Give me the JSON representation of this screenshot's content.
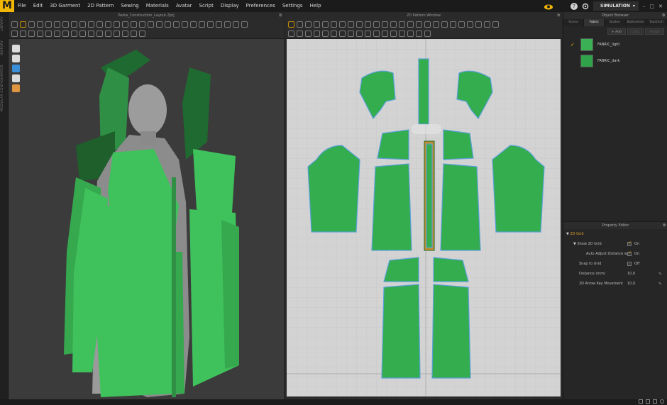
{
  "app": {
    "logo": "M",
    "menu": [
      "File",
      "Edit",
      "3D Garment",
      "2D Pattern",
      "Sewing",
      "Materials",
      "Avatar",
      "Script",
      "Display",
      "Preferences",
      "Settings",
      "Help"
    ],
    "simulation_label": "SIMULATION",
    "help_glyph": "?",
    "window_controls": [
      "–",
      "□",
      "✕"
    ]
  },
  "left_tabs": [
    "LIBRARY",
    "HISTORY",
    "MODULAR CONFIGURATOR"
  ],
  "window3d": {
    "title": "Parka_Construction_Layout.Zprj"
  },
  "window2d": {
    "title": "2D Pattern Window"
  },
  "object_browser": {
    "title": "Object Browser",
    "tabs": [
      "Scene",
      "Fabric",
      "Button",
      "Buttonhole",
      "Topstitch"
    ],
    "active_tab": "Fabric",
    "add_label": "+ Add",
    "copy_label": "Copy",
    "assign_label": "Assign",
    "fabrics": [
      {
        "name": "FABRIC_light",
        "color": "#3ec35c",
        "selected": true
      },
      {
        "name": "FABRIC_dark",
        "color": "#2fa24a",
        "selected": false
      }
    ]
  },
  "property_editor": {
    "title": "Property Editor",
    "section": "2D Grid",
    "rows": [
      {
        "label": "Show 2D Grid",
        "value": "On",
        "checked": true,
        "indent": 2,
        "expander": true
      },
      {
        "label": "Auto Adjust Distance wi",
        "value": "On",
        "checked": true,
        "indent": 3
      },
      {
        "label": "Snap to Grid",
        "value": "Off",
        "checked": false,
        "indent": 1
      },
      {
        "label": "Distance (mm)",
        "value": "10,0",
        "indent": 1,
        "editable": true
      },
      {
        "label": "2D Arrow Key Movement",
        "value": "10,0",
        "indent": 1,
        "editable": true
      }
    ]
  },
  "colors": {
    "accent": "#f0b400",
    "garment_light": "#3fc15c",
    "garment_mid": "#36a94f",
    "garment_dark": "#1f6a30",
    "pattern_fill": "#33ad4e",
    "pattern_outline": "#5aa0d8",
    "grid_bg": "#d3d3d3"
  },
  "icons": {
    "cloud": "cloud-icon",
    "help": "help-icon",
    "settings": "settings-icon",
    "simulation": "simulation-icon"
  }
}
